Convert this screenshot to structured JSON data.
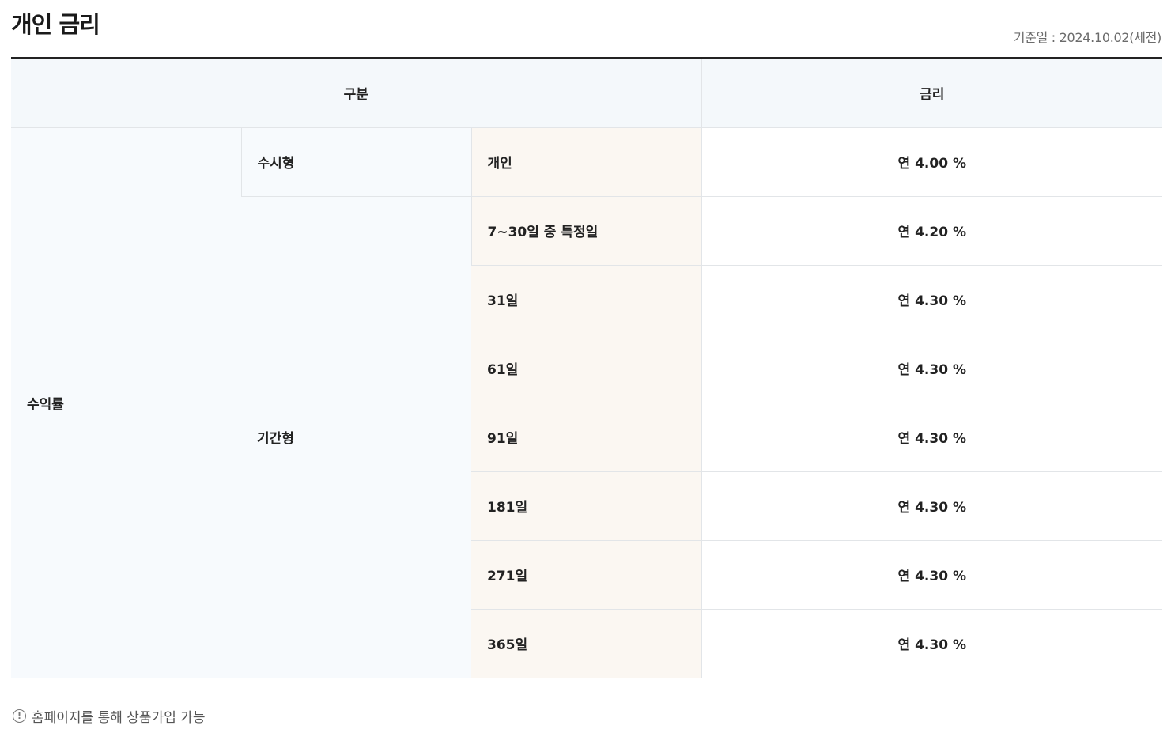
{
  "header": {
    "title": "개인 금리",
    "base_date": "기준일 : 2024.10.02(세전)"
  },
  "table": {
    "headers": {
      "category": "구분",
      "rate": "금리"
    },
    "group_label": "수익률",
    "types": {
      "demand": "수시형",
      "term": "기간형"
    },
    "rows": [
      {
        "term": "개인",
        "rate": "연 4.00 %"
      },
      {
        "term": "7~30일 중 특정일",
        "rate": "연 4.20 %"
      },
      {
        "term": "31일",
        "rate": "연 4.30 %"
      },
      {
        "term": "61일",
        "rate": "연 4.30 %"
      },
      {
        "term": "91일",
        "rate": "연 4.30 %"
      },
      {
        "term": "181일",
        "rate": "연 4.30 %"
      },
      {
        "term": "271일",
        "rate": "연 4.30 %"
      },
      {
        "term": "365일",
        "rate": "연 4.30 %"
      }
    ]
  },
  "note": {
    "icon": "info-icon",
    "text": "홈페이지를 통해 상품가입 가능"
  }
}
